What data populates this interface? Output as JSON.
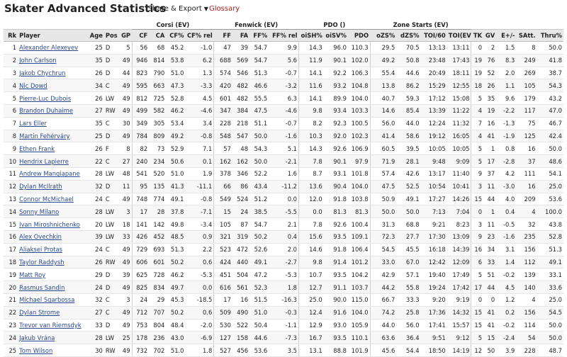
{
  "page": {
    "title": "Skater Advanced Statistics",
    "share_label": "Share & Export",
    "glossary_label": "Glossary"
  },
  "groups": {
    "corsi": "Corsi (EV)",
    "fenwick": "Fenwick (EV)",
    "pdo": "PDO ()",
    "zone": "Zone Starts (EV)"
  },
  "columns": [
    "Rk",
    "Player",
    "Age",
    "Pos",
    "GP",
    "CF",
    "CA",
    "CF%",
    "CF% rel",
    "FF",
    "FA",
    "FF%",
    "FF% rel",
    "oiSH%",
    "oiSV%",
    "PDO",
    "oZS%",
    "dZS%",
    "TOI/60",
    "TOI(EV)",
    "TK",
    "GV",
    "E+/-",
    "SAtt.",
    "Thru%"
  ],
  "rows": [
    [
      "1",
      "Alexander Alexeyev",
      "25",
      "D",
      "5",
      "56",
      "68",
      "45.2",
      "-1.0",
      "47",
      "39",
      "54.7",
      "9.9",
      "14.3",
      "96.0",
      "110.3",
      "29.5",
      "70.5",
      "13:13",
      "13:11",
      "0",
      "2",
      "1.5",
      "8",
      "50.0"
    ],
    [
      "2",
      "John Carlson",
      "35",
      "D",
      "49",
      "946",
      "814",
      "53.8",
      "6.2",
      "688",
      "569",
      "54.7",
      "5.6",
      "11.9",
      "90.1",
      "102.0",
      "49.2",
      "50.8",
      "23:48",
      "17:43",
      "19",
      "76",
      "8.3",
      "249",
      "41.8"
    ],
    [
      "3",
      "Jakob Chychrun",
      "26",
      "D",
      "44",
      "823",
      "790",
      "51.0",
      "1.3",
      "574",
      "546",
      "51.3",
      "-0.7",
      "14.1",
      "92.2",
      "106.3",
      "55.4",
      "44.6",
      "20:49",
      "18:11",
      "19",
      "52",
      "2.0",
      "269",
      "38.7"
    ],
    [
      "4",
      "Nic Dowd",
      "34",
      "C",
      "49",
      "595",
      "663",
      "47.3",
      "-3.3",
      "420",
      "482",
      "46.6",
      "-3.2",
      "11.6",
      "93.2",
      "104.8",
      "13.8",
      "86.2",
      "15:29",
      "12:55",
      "18",
      "26",
      "1.1",
      "105",
      "54.3"
    ],
    [
      "5",
      "Pierre-Luc Dubois",
      "26",
      "LW",
      "49",
      "812",
      "725",
      "52.8",
      "4.5",
      "601",
      "482",
      "55.5",
      "6.3",
      "14.1",
      "89.9",
      "104.0",
      "40.7",
      "59.3",
      "17:12",
      "15:08",
      "5",
      "35",
      "9.6",
      "179",
      "43.2"
    ],
    [
      "6",
      "Brandon Duhaime",
      "27",
      "RW",
      "49",
      "499",
      "582",
      "46.2",
      "-4.6",
      "347",
      "384",
      "47.5",
      "-4.6",
      "9.8",
      "93.4",
      "103.3",
      "14.6",
      "85.4",
      "13:39",
      "11:22",
      "4",
      "19",
      "-2.2",
      "117",
      "47.0"
    ],
    [
      "7",
      "Lars Eller",
      "35",
      "C",
      "30",
      "349",
      "305",
      "53.4",
      "3.4",
      "228",
      "218",
      "51.1",
      "-0.7",
      "8.2",
      "92.3",
      "100.5",
      "56.0",
      "44.0",
      "12:24",
      "11:32",
      "7",
      "16",
      "-1.3",
      "75",
      "46.7"
    ],
    [
      "8",
      "Martin Fehérváry",
      "25",
      "D",
      "49",
      "784",
      "809",
      "49.2",
      "-0.8",
      "548",
      "547",
      "50.0",
      "-1.6",
      "10.3",
      "92.0",
      "102.3",
      "41.4",
      "58.6",
      "19:12",
      "16:05",
      "4",
      "41",
      "-1.9",
      "125",
      "42.4"
    ],
    [
      "9",
      "Ethen Frank",
      "26",
      "F",
      "8",
      "82",
      "73",
      "52.9",
      "7.1",
      "57",
      "48",
      "54.3",
      "5.1",
      "14.3",
      "92.6",
      "106.9",
      "60.5",
      "39.5",
      "10:05",
      "10:05",
      "5",
      "1",
      "0.8",
      "16",
      "50.0"
    ],
    [
      "10",
      "Hendrix Lapierre",
      "22",
      "C",
      "27",
      "240",
      "234",
      "50.6",
      "0.1",
      "162",
      "162",
      "50.0",
      "-2.1",
      "7.8",
      "90.1",
      "97.9",
      "71.9",
      "28.1",
      "9:48",
      "9:09",
      "5",
      "17",
      "-2.8",
      "37",
      "48.6"
    ],
    [
      "11",
      "Andrew Mangiapane",
      "28",
      "LW",
      "48",
      "541",
      "520",
      "51.0",
      "1.9",
      "378",
      "346",
      "52.2",
      "1.6",
      "8.7",
      "93.1",
      "101.8",
      "57.4",
      "42.6",
      "13:17",
      "11:40",
      "9",
      "37",
      "4.2",
      "111",
      "54.1"
    ],
    [
      "12",
      "Dylan McIlrath",
      "32",
      "D",
      "11",
      "95",
      "135",
      "41.3",
      "-11.1",
      "66",
      "86",
      "43.4",
      "-11.2",
      "13.6",
      "90.4",
      "104.0",
      "47.5",
      "52.5",
      "10:54",
      "10:41",
      "3",
      "11",
      "-3.0",
      "16",
      "25.0"
    ],
    [
      "13",
      "Connor McMichael",
      "24",
      "C",
      "49",
      "748",
      "774",
      "49.1",
      "-0.8",
      "549",
      "524",
      "51.2",
      "0.0",
      "12.0",
      "91.8",
      "103.8",
      "50.9",
      "49.1",
      "17:27",
      "14:26",
      "15",
      "44",
      "4.0",
      "209",
      "53.6"
    ],
    [
      "14",
      "Sonny Milano",
      "28",
      "LW",
      "3",
      "17",
      "28",
      "37.8",
      "-7.1",
      "15",
      "24",
      "38.5",
      "-5.5",
      "0.0",
      "81.3",
      "81.3",
      "50.0",
      "50.0",
      "7:13",
      "7:04",
      "0",
      "1",
      "0.4",
      "4",
      "100.0"
    ],
    [
      "15",
      "Ivan Miroshnichenko",
      "20",
      "LW",
      "18",
      "141",
      "142",
      "49.8",
      "-3.4",
      "105",
      "87",
      "54.7",
      "2.1",
      "7.8",
      "92.6",
      "100.4",
      "31.3",
      "68.8",
      "9:21",
      "8:23",
      "3",
      "11",
      "-0.5",
      "32",
      "43.8"
    ],
    [
      "16",
      "Alex Ovechkin",
      "39",
      "LW",
      "33",
      "426",
      "452",
      "48.5",
      "0.9",
      "321",
      "319",
      "50.2",
      "0.4",
      "15.6",
      "93.5",
      "109.1",
      "72.3",
      "27.7",
      "17:30",
      "13:09",
      "9",
      "23",
      "-1.6",
      "235",
      "52.8"
    ],
    [
      "17",
      "Aliaksei Protas",
      "24",
      "C",
      "49",
      "729",
      "693",
      "51.3",
      "2.2",
      "523",
      "472",
      "52.6",
      "2.0",
      "14.6",
      "91.8",
      "106.4",
      "54.5",
      "45.5",
      "16:18",
      "14:39",
      "16",
      "34",
      "3.1",
      "156",
      "51.3"
    ],
    [
      "18",
      "Taylor Raddysh",
      "26",
      "RW",
      "49",
      "606",
      "601",
      "50.2",
      "0.6",
      "424",
      "440",
      "49.1",
      "-2.7",
      "9.8",
      "91.4",
      "101.2",
      "33.0",
      "67.0",
      "12:42",
      "12:09",
      "6",
      "33",
      "1.4",
      "112",
      "49.1"
    ],
    [
      "19",
      "Matt Roy",
      "29",
      "D",
      "39",
      "625",
      "728",
      "46.2",
      "-5.3",
      "451",
      "504",
      "47.2",
      "-5.3",
      "10.7",
      "93.5",
      "104.2",
      "42.9",
      "57.1",
      "19:40",
      "17:49",
      "5",
      "51",
      "-0.2",
      "139",
      "33.1"
    ],
    [
      "20",
      "Rasmus Sandin",
      "24",
      "D",
      "49",
      "825",
      "834",
      "49.7",
      "0.0",
      "616",
      "561",
      "52.3",
      "1.8",
      "12.7",
      "91.1",
      "103.7",
      "44.2",
      "55.8",
      "19:24",
      "17:42",
      "17",
      "44",
      "4.5",
      "140",
      "33.6"
    ],
    [
      "21",
      "Michael Sgarbossa",
      "32",
      "C",
      "3",
      "24",
      "29",
      "45.3",
      "-18.5",
      "17",
      "16",
      "51.5",
      "-16.3",
      "25.0",
      "90.0",
      "115.0",
      "66.7",
      "33.3",
      "9:20",
      "9:19",
      "0",
      "0",
      "1.2",
      "4",
      "25.0"
    ],
    [
      "22",
      "Dylan Strome",
      "27",
      "C",
      "49",
      "712",
      "707",
      "50.2",
      "0.6",
      "509",
      "490",
      "51.0",
      "-0.3",
      "12.4",
      "91.6",
      "104.0",
      "74.2",
      "25.8",
      "17:36",
      "14:32",
      "15",
      "41",
      "0.2",
      "156",
      "54.5"
    ],
    [
      "23",
      "Trevor van Riemsdyk",
      "33",
      "D",
      "49",
      "753",
      "804",
      "48.4",
      "-2.0",
      "530",
      "522",
      "50.4",
      "-1.1",
      "12.9",
      "93.0",
      "105.9",
      "44.0",
      "56.0",
      "17:41",
      "15:57",
      "15",
      "41",
      "-0.2",
      "114",
      "50.0"
    ],
    [
      "24",
      "Jakub Vrána",
      "28",
      "LW",
      "25",
      "178",
      "236",
      "43.0",
      "-6.9",
      "127",
      "158",
      "44.6",
      "-7.3",
      "16.7",
      "93.5",
      "110.1",
      "63.6",
      "36.4",
      "9:51",
      "9:12",
      "5",
      "15",
      "-2.4",
      "54",
      "50.0"
    ],
    [
      "25",
      "Tom Wilson",
      "30",
      "RW",
      "49",
      "732",
      "702",
      "51.0",
      "1.8",
      "527",
      "456",
      "53.6",
      "3.5",
      "13.1",
      "88.8",
      "101.9",
      "45.6",
      "54.4",
      "18:50",
      "14:19",
      "12",
      "50",
      "3.9",
      "228",
      "48.7"
    ]
  ]
}
